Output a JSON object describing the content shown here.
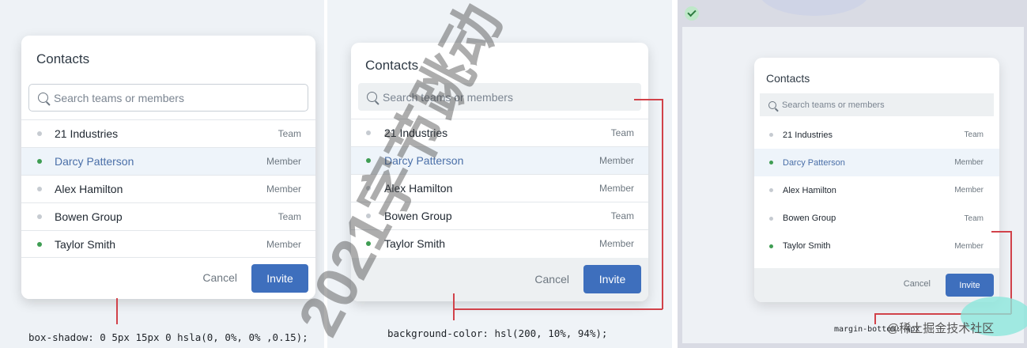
{
  "cards": [
    {
      "title": "Contacts",
      "search_placeholder": "Search teams or members",
      "rows": [
        {
          "name": "21 Industries",
          "kind": "Team",
          "online": false
        },
        {
          "name": "Darcy Patterson",
          "kind": "Member",
          "online": true
        },
        {
          "name": "Alex Hamilton",
          "kind": "Member",
          "online": false
        },
        {
          "name": "Bowen Group",
          "kind": "Team",
          "online": false
        },
        {
          "name": "Taylor Smith",
          "kind": "Member",
          "online": true
        }
      ],
      "cancel_label": "Cancel",
      "invite_label": "Invite"
    },
    {
      "title": "Contacts",
      "search_placeholder": "Search teams or members",
      "rows": [
        {
          "name": "21 Industries",
          "kind": "Team",
          "online": false
        },
        {
          "name": "Darcy Patterson",
          "kind": "Member",
          "online": true
        },
        {
          "name": "Alex Hamilton",
          "kind": "Member",
          "online": false
        },
        {
          "name": "Bowen Group",
          "kind": "Team",
          "online": false
        },
        {
          "name": "Taylor Smith",
          "kind": "Member",
          "online": true
        }
      ],
      "cancel_label": "Cancel",
      "invite_label": "Invite"
    },
    {
      "title": "Contacts",
      "search_placeholder": "Search teams or members",
      "rows": [
        {
          "name": "21 Industries",
          "kind": "Team",
          "online": false
        },
        {
          "name": "Darcy Patterson",
          "kind": "Member",
          "online": true
        },
        {
          "name": "Alex Hamilton",
          "kind": "Member",
          "online": false
        },
        {
          "name": "Bowen Group",
          "kind": "Team",
          "online": false
        },
        {
          "name": "Taylor Smith",
          "kind": "Member",
          "online": true
        }
      ],
      "cancel_label": "Cancel",
      "invite_label": "Invite"
    }
  ],
  "captions": {
    "shadow": "box-shadow: 0 5px 15px 0 hsla(0, 0%, 0% ,0.15);",
    "background": "background-color: hsl(200, 10%, 94%);",
    "margin": "margin-bottom: 4px"
  },
  "overlay_mark": "2021字节跳动",
  "watermark": "@稀土掘金技术社区",
  "colors": {
    "accent": "#3e6fbd",
    "online": "#3f9d53",
    "offline": "#c6cbd1",
    "annotation": "#d1424a",
    "footer_gray": "#edf0f2"
  }
}
